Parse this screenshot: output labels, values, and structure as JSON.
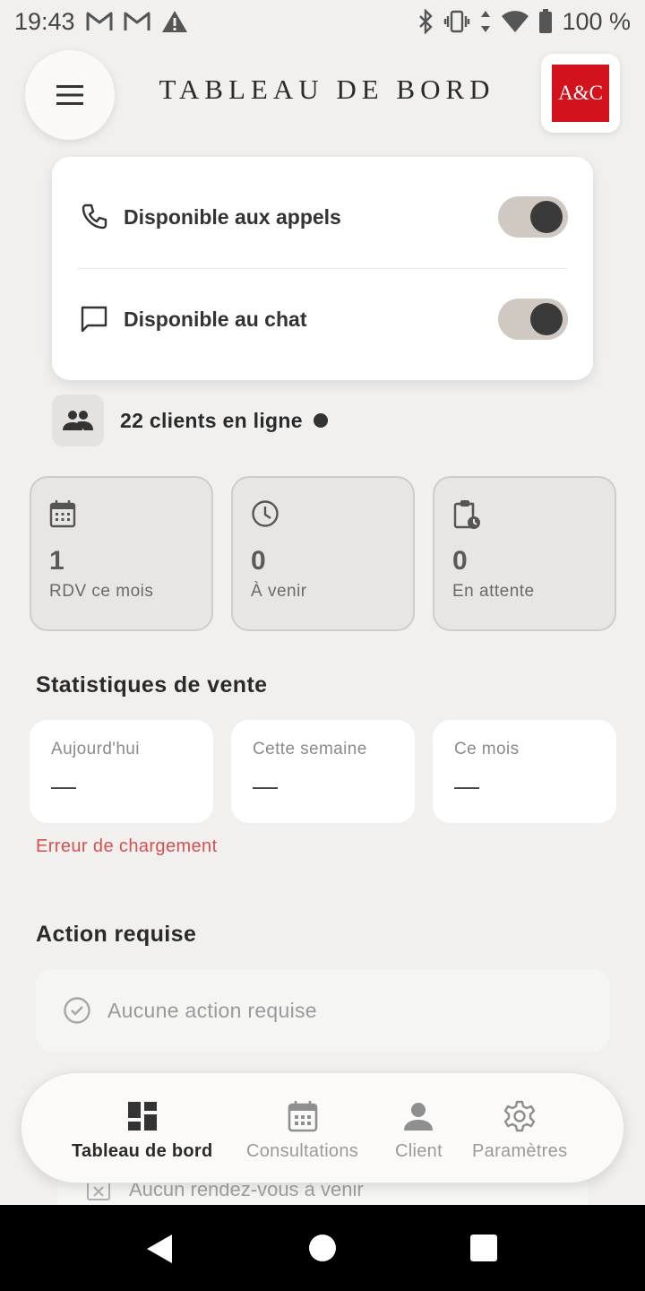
{
  "status_bar": {
    "time": "19:43",
    "battery": "100 %",
    "icons": [
      "gmail-icon",
      "gmail-icon",
      "warning-icon",
      "bluetooth-icon",
      "vibrate-icon",
      "data-arrows-icon",
      "wifi-icon",
      "battery-icon"
    ]
  },
  "header": {
    "title": "TABLEAU DE BORD",
    "logo_text": "A&C",
    "menu_icon": "hamburger-menu-icon"
  },
  "availability": {
    "calls_label": "Disponible aux appels",
    "calls_on": true,
    "chat_label": "Disponible au chat",
    "chat_on": true
  },
  "online": {
    "text": "22 clients en ligne"
  },
  "stats": [
    {
      "icon": "calendar-icon",
      "value": "1",
      "label": "RDV ce mois"
    },
    {
      "icon": "clock-icon",
      "value": "0",
      "label": "À venir"
    },
    {
      "icon": "clipboard-clock-icon",
      "value": "0",
      "label": "En attente"
    }
  ],
  "sales": {
    "title": "Statistiques de vente",
    "cards": [
      {
        "label": "Aujourd'hui",
        "value": "—"
      },
      {
        "label": "Cette semaine",
        "value": "—"
      },
      {
        "label": "Ce mois",
        "value": "—"
      }
    ],
    "error": "Erreur de chargement"
  },
  "actions": {
    "title": "Action requise",
    "empty_text": "Aucune action requise"
  },
  "upcoming": {
    "empty_text": "Aucun rendez-vous à venir"
  },
  "nav": [
    {
      "label": "Tableau de bord",
      "icon": "dashboard-icon",
      "active": true
    },
    {
      "label": "Consultations",
      "icon": "calendar-icon",
      "active": false
    },
    {
      "label": "Client",
      "icon": "person-icon",
      "active": false
    },
    {
      "label": "Paramètres",
      "icon": "gear-icon",
      "active": false
    }
  ],
  "colors": {
    "background": "#f1f0ee",
    "logo_red": "#d2131b",
    "error_red": "#d65050",
    "toggle_track": "#cfc9c1",
    "toggle_knob": "#3a3a3a"
  }
}
